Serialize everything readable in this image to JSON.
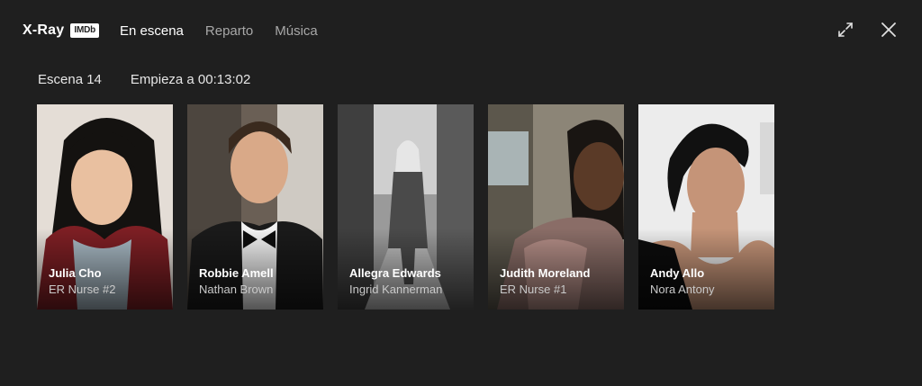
{
  "header": {
    "title": "X-Ray",
    "badge": "IMDb",
    "tabs": [
      {
        "label": "En escena",
        "active": true
      },
      {
        "label": "Reparto",
        "active": false
      },
      {
        "label": "Música",
        "active": false
      }
    ],
    "icons": [
      "expand-icon",
      "close-icon"
    ]
  },
  "scene": {
    "label": "Escena 14",
    "start": "Empieza a 00:13:02"
  },
  "cast": [
    {
      "actor": "Julia Cho",
      "role": "ER Nurse #2"
    },
    {
      "actor": "Robbie Amell",
      "role": "Nathan Brown"
    },
    {
      "actor": "Allegra Edwards",
      "role": "Ingrid Kannerman"
    },
    {
      "actor": "Judith Moreland",
      "role": "ER Nurse #1"
    },
    {
      "actor": "Andy Allo",
      "role": "Nora Antony"
    }
  ],
  "colors": {
    "background": "#1f1f1f",
    "active_tab": "#ffffff",
    "inactive_tab": "#a8a8a8"
  }
}
